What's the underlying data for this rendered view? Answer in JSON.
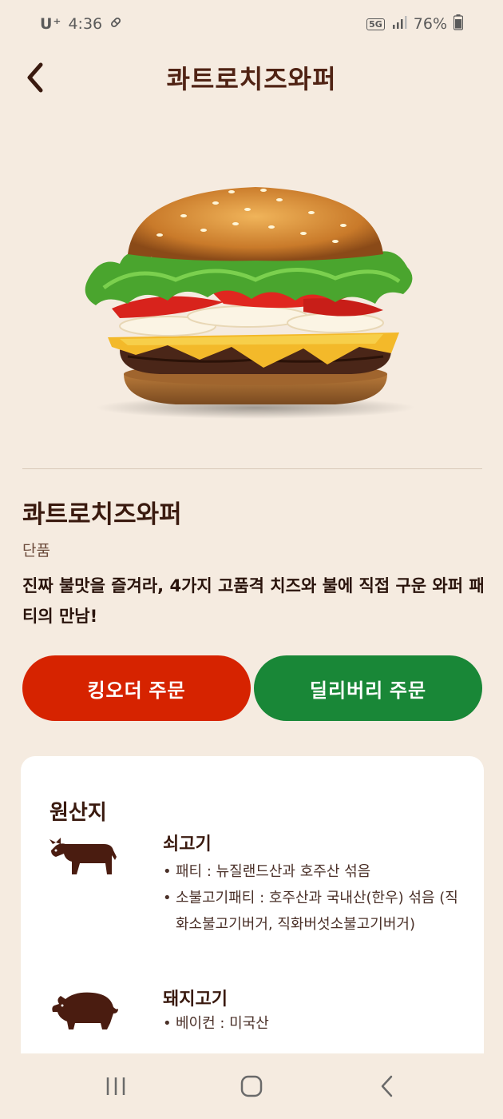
{
  "status_bar": {
    "carrier": "U⁺",
    "time": "4:36",
    "network": "5G",
    "battery": "76%"
  },
  "header": {
    "title": "콰트로치즈와퍼",
    "back_icon": "chevron-left-icon"
  },
  "product": {
    "name": "콰트로치즈와퍼",
    "type": "단품",
    "description": "진짜 불맛을 즐겨라, 4가지 고품격 치즈와 불에 직접 구운 와퍼 패티의 만남!"
  },
  "buttons": {
    "kingorder_label": "킹오더 주문",
    "delivery_label": "딜리버리 주문"
  },
  "origin": {
    "title": "원산지",
    "items": [
      {
        "meat": "쇠고기",
        "icon": "cow-icon",
        "details": [
          "패티 : 뉴질랜드산과 호주산 섞음",
          "소불고기패티 : 호주산과 국내산(한우) 섞음 (직화소불고기버거, 직화버섯소불고기버거)"
        ]
      },
      {
        "meat": "돼지고기",
        "icon": "pig-icon",
        "details": [
          "베이컨 : 미국산"
        ]
      }
    ]
  },
  "colors": {
    "background": "#f5ebe0",
    "brown": "#502314",
    "red": "#d62300",
    "green": "#198737"
  }
}
